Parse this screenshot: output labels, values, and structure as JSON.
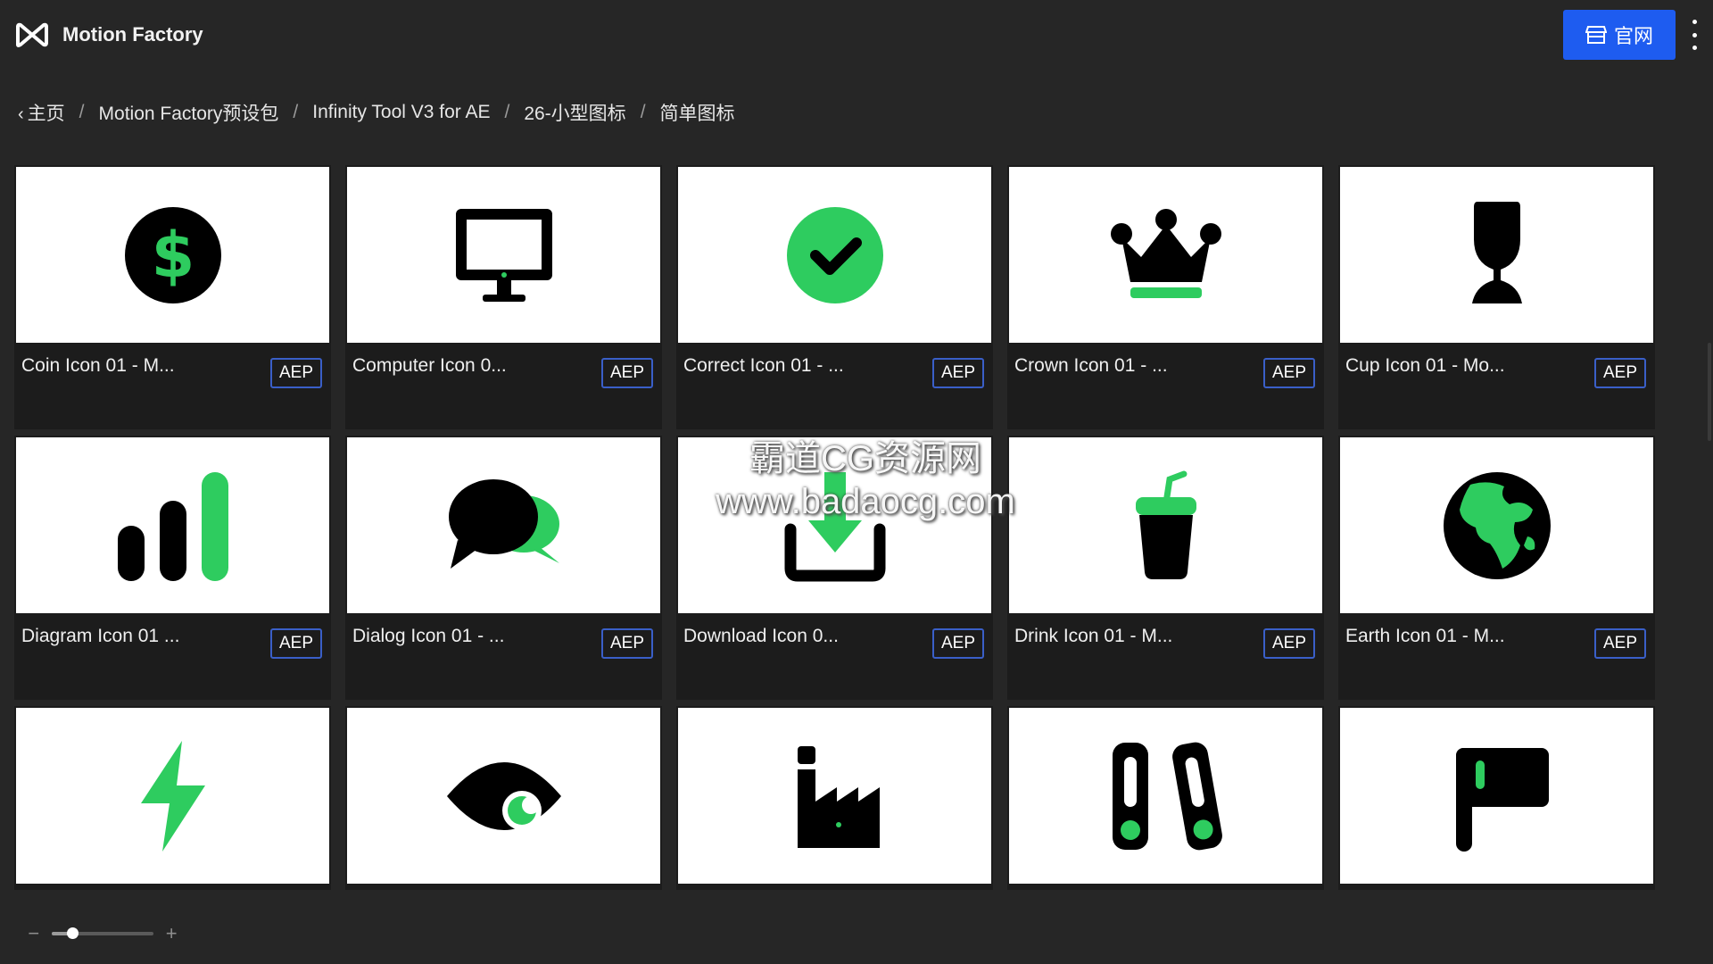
{
  "app": {
    "name": "Motion Factory",
    "logo_icon": "infinity-m-logo-icon"
  },
  "header": {
    "official_label": "官网",
    "official_icon": "storefront-icon",
    "more_icon": "more-vertical-icon"
  },
  "breadcrumb": [
    "主页",
    "Motion Factory预设包",
    "Infinity Tool V3 for AE",
    "26-小型图标",
    "简单图标"
  ],
  "breadcrumb_separator": "/",
  "accent": "#2ecc5f",
  "primary": "#1e5cf0",
  "items": [
    {
      "title": "Coin Icon 01 - M...",
      "badge": "AEP",
      "icon": "coin-icon"
    },
    {
      "title": "Computer Icon 0...",
      "badge": "AEP",
      "icon": "computer-icon"
    },
    {
      "title": "Correct Icon 01 - ...",
      "badge": "AEP",
      "icon": "correct-icon"
    },
    {
      "title": "Crown Icon 01 - ...",
      "badge": "AEP",
      "icon": "crown-icon"
    },
    {
      "title": "Cup Icon 01 - Mo...",
      "badge": "AEP",
      "icon": "cup-icon"
    },
    {
      "title": "Diagram Icon 01 ...",
      "badge": "AEP",
      "icon": "diagram-icon"
    },
    {
      "title": "Dialog Icon 01 - ...",
      "badge": "AEP",
      "icon": "dialog-icon"
    },
    {
      "title": "Download Icon 0...",
      "badge": "AEP",
      "icon": "download-icon"
    },
    {
      "title": "Drink Icon 01 - M...",
      "badge": "AEP",
      "icon": "drink-icon"
    },
    {
      "title": "Earth Icon 01 - M...",
      "badge": "AEP",
      "icon": "earth-icon"
    },
    {
      "title": "",
      "badge": "",
      "icon": "energy-icon"
    },
    {
      "title": "",
      "badge": "",
      "icon": "eye-icon"
    },
    {
      "title": "",
      "badge": "",
      "icon": "factory-icon"
    },
    {
      "title": "",
      "badge": "",
      "icon": "fader-icon"
    },
    {
      "title": "",
      "badge": "",
      "icon": "flag-icon"
    }
  ],
  "watermark": {
    "line1": "霸道CG资源网",
    "line2": "www.badaocg.com"
  },
  "zoom": {
    "level": 0.2,
    "minus": "−",
    "plus": "+"
  }
}
